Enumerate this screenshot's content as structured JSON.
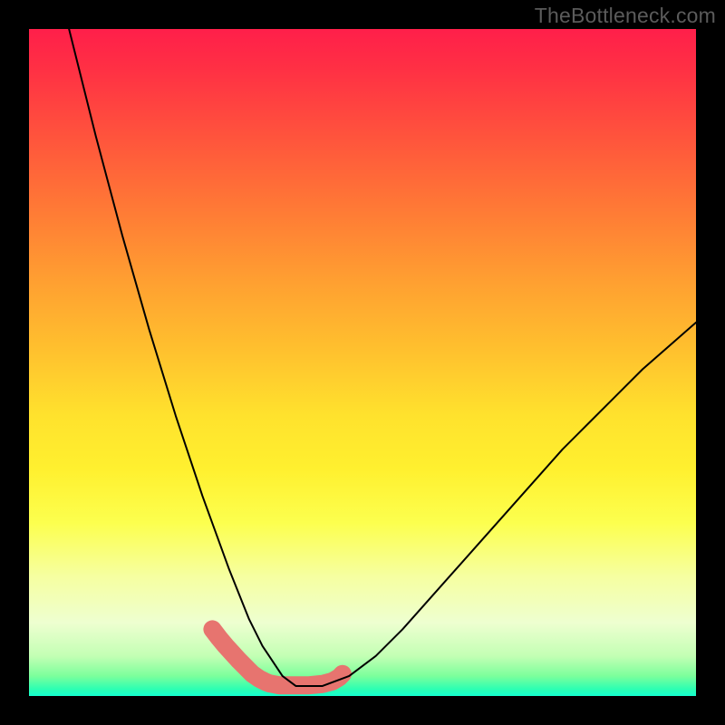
{
  "watermark": {
    "text": "TheBottleneck.com"
  },
  "chart_data": {
    "type": "line",
    "title": "",
    "xlabel": "",
    "ylabel": "",
    "xlim": [
      0,
      100
    ],
    "ylim": [
      0,
      100
    ],
    "grid": false,
    "series": [
      {
        "name": "bottleneck-curve",
        "x": [
          6,
          8,
          10,
          12,
          14,
          16,
          18,
          20,
          22,
          24,
          26,
          28,
          30,
          32,
          33,
          34,
          35,
          36,
          38,
          40,
          44,
          48,
          52,
          56,
          60,
          64,
          68,
          72,
          76,
          80,
          84,
          88,
          92,
          96,
          100
        ],
        "y": [
          100,
          92,
          84,
          76.5,
          69,
          62,
          55,
          48.5,
          42,
          36,
          30,
          24.5,
          19,
          14,
          11.5,
          9.5,
          7.5,
          6,
          3,
          1.5,
          1.5,
          3,
          6,
          10,
          14.5,
          19,
          23.5,
          28,
          32.5,
          37,
          41,
          45,
          49,
          52.5,
          56
        ],
        "color": "#000000",
        "width": 2
      },
      {
        "name": "highlight-band",
        "x": [
          27.5,
          28.5,
          29.5,
          30.5,
          31.5,
          32.5,
          33.0,
          33.5,
          34.5,
          35.5,
          36.0,
          36.5,
          37.5,
          38.5,
          39.5,
          42.0,
          44.0,
          45.5,
          46.5,
          47.0
        ],
        "y": [
          10.0,
          8.7,
          7.5,
          6.4,
          5.3,
          4.3,
          3.8,
          3.3,
          2.6,
          2.1,
          1.9,
          1.8,
          1.6,
          1.6,
          1.6,
          1.6,
          1.8,
          2.2,
          2.8,
          3.3
        ],
        "color": "#e7746f",
        "width": 20
      }
    ]
  }
}
